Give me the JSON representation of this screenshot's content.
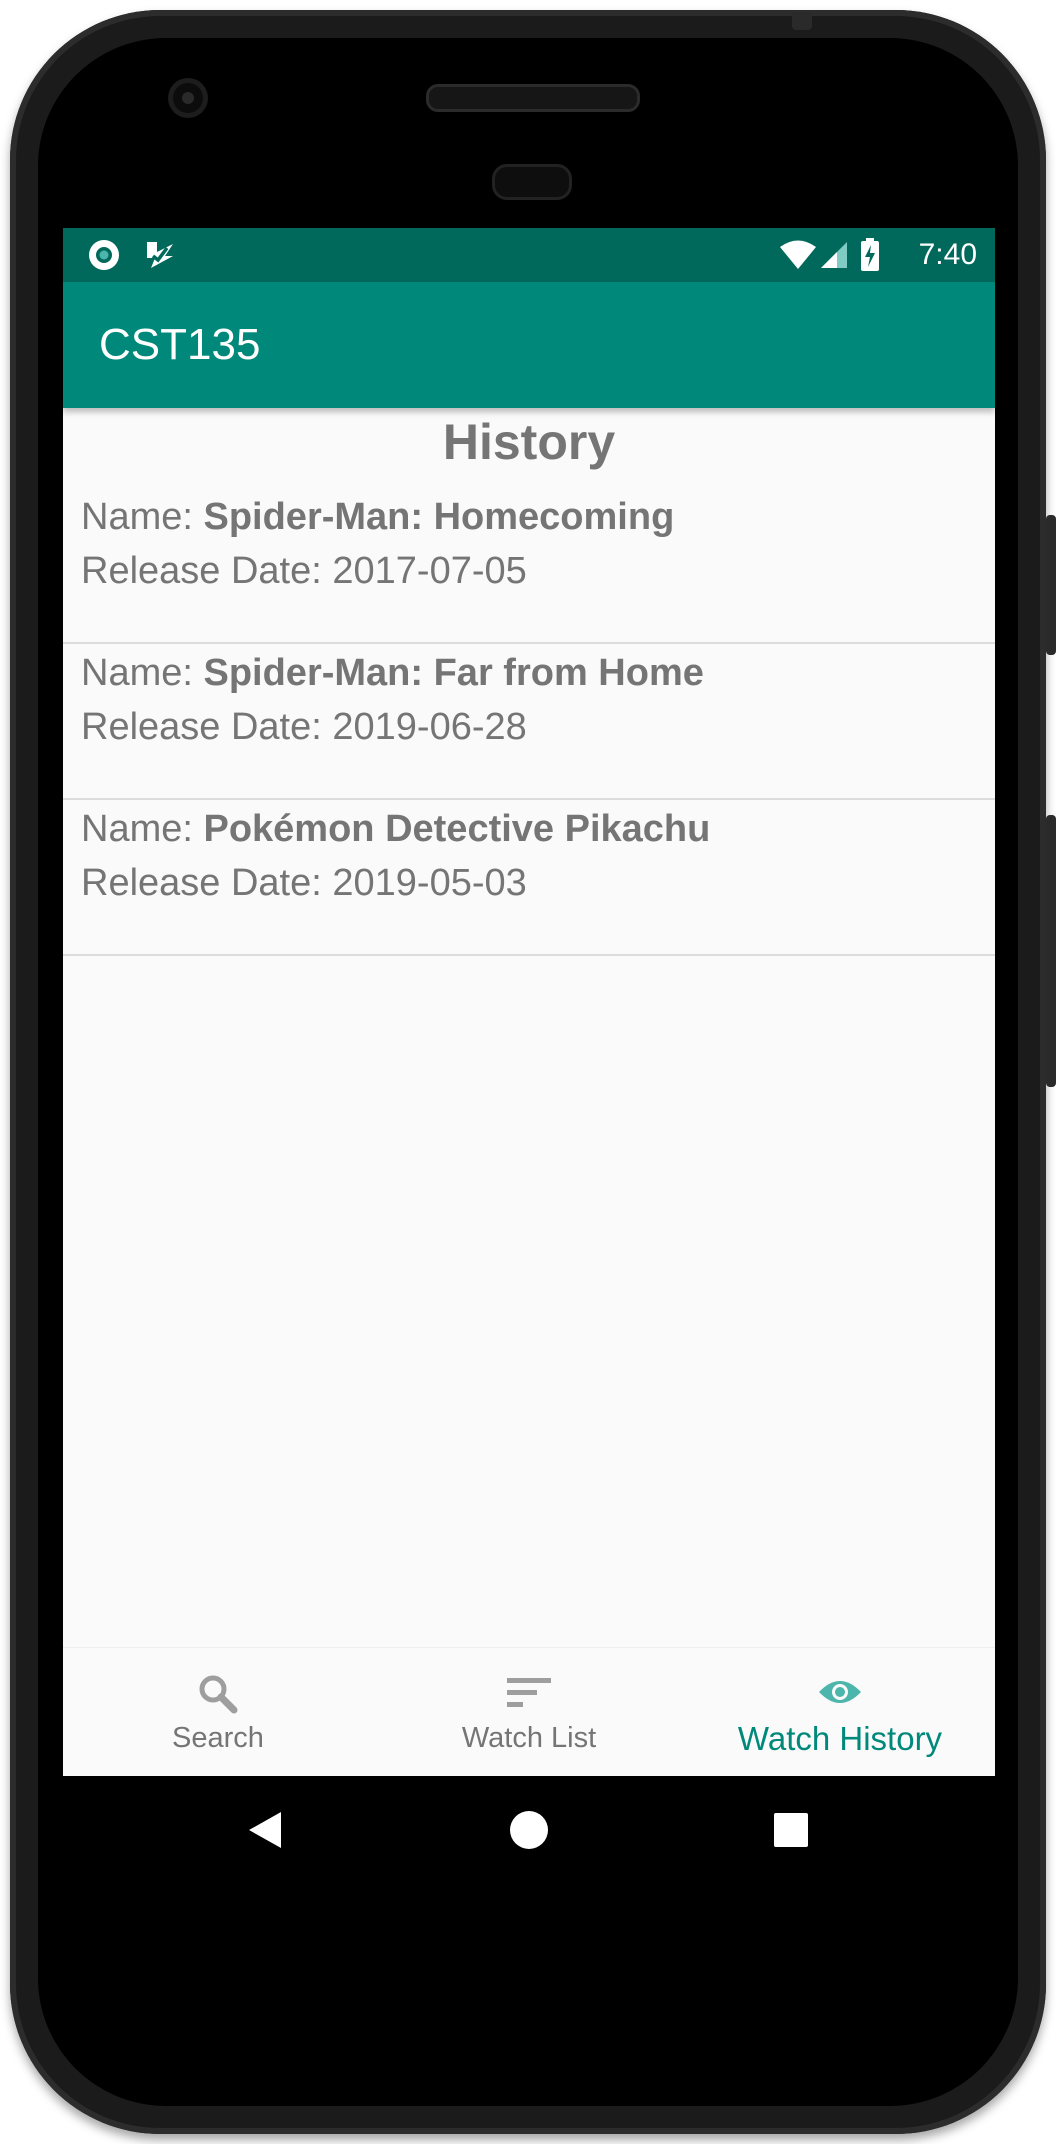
{
  "status_bar": {
    "time": "7:40",
    "icons": [
      "notification-circle-icon",
      "play-protect-icon",
      "wifi-icon",
      "cell-signal-icon",
      "battery-charging-icon"
    ]
  },
  "app_bar": {
    "title": "CST135"
  },
  "page": {
    "title": "History"
  },
  "history": {
    "name_prefix": "Name: ",
    "date_prefix": "Release Date: ",
    "items": [
      {
        "name": "Spider-Man: Homecoming",
        "release_date": "2017-07-05"
      },
      {
        "name": "Spider-Man: Far from Home",
        "release_date": "2019-06-28"
      },
      {
        "name": "Pokémon Detective Pikachu",
        "release_date": "2019-05-03"
      }
    ]
  },
  "bottom_nav": {
    "items": [
      {
        "label": "Search",
        "icon": "search-icon",
        "active": false
      },
      {
        "label": "Watch List",
        "icon": "sort-list-icon",
        "active": false
      },
      {
        "label": "Watch History",
        "icon": "eye-icon",
        "active": true
      }
    ]
  },
  "system_nav": {
    "buttons": [
      "back-icon",
      "home-icon",
      "recents-icon"
    ]
  },
  "colors": {
    "primary": "#00897b",
    "primary_dark": "#00695c",
    "text_secondary": "#757575",
    "background": "#fafafa"
  }
}
